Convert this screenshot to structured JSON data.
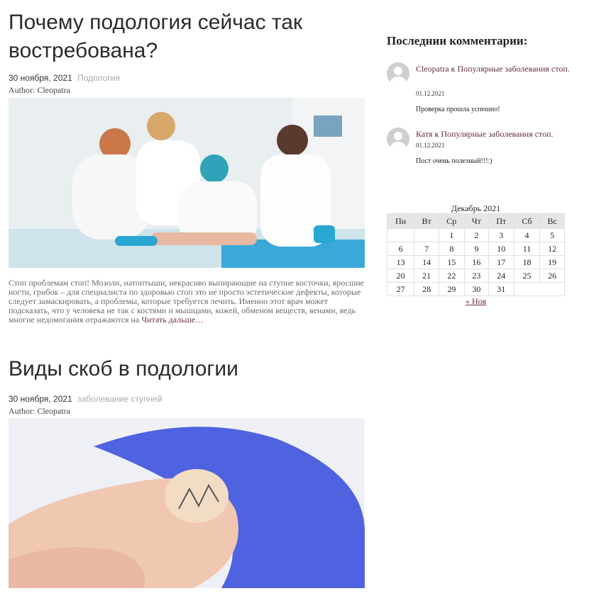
{
  "posts": [
    {
      "title": "Почему подология сейчас так востребована?",
      "date": "30 ноября, 2021",
      "category": "Подология",
      "author": "Author: Cleopatra",
      "excerpt": "Стоп проблемам стоп! Мозоли, натоптыши, некрасиво выпирающие на ступне косточки, вросшие ногти, грибок – для специалиста по здоровью стоп это не просто эстетические дефекты, которые следует замаскировать, а проблемы, которые требуется лечить. Именно этот врач может подсказать, что у человека не так с костями и мышцами, кожей, обменом веществ, венами, ведь многие недомогания отражаются на",
      "read_more": "Читать дальше…"
    },
    {
      "title": "Виды скоб в подологии",
      "date": "30 ноября, 2021",
      "category": "заболевание ступней",
      "author": "Author: Cleopatra"
    }
  ],
  "sidebar": {
    "recent_comments_title": "Последнии комментарии:",
    "comments": [
      {
        "author": "Cleopatra",
        "connector": "к",
        "post": "Популярные заболевания стоп.",
        "date": "01.12.2021",
        "text": "Проверка прошла успешно!"
      },
      {
        "author": "Катя",
        "connector": "к",
        "post": "Популярные заболевания стоп.",
        "date": "01.12.2021",
        "text": "Пост очень полезный!!!:)"
      }
    ],
    "calendar": {
      "caption": "Декабрь 2021",
      "weekdays": [
        "Пн",
        "Вт",
        "Ср",
        "Чт",
        "Пт",
        "Сб",
        "Вс"
      ],
      "weeks": [
        [
          "",
          "",
          "1",
          "2",
          "3",
          "4",
          "5"
        ],
        [
          "6",
          "7",
          "8",
          "9",
          "10",
          "11",
          "12"
        ],
        [
          "13",
          "14",
          "15",
          "16",
          "17",
          "18",
          "19"
        ],
        [
          "20",
          "21",
          "22",
          "23",
          "24",
          "25",
          "26"
        ],
        [
          "27",
          "28",
          "29",
          "30",
          "31",
          "",
          ""
        ]
      ],
      "prev_link": "« Ноя"
    }
  },
  "colors": {
    "link": "#6a2b4a",
    "category": "#aaaaaa",
    "text_gray": "#6a6a6a"
  }
}
